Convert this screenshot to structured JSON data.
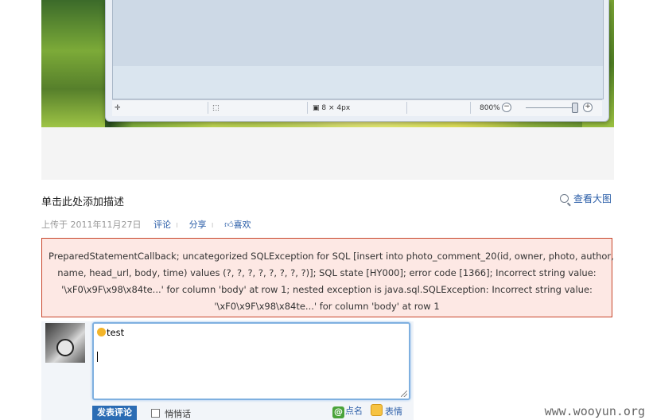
{
  "screenshot": {
    "statusbar": {
      "dimensions": "8 × 4px",
      "zoom_level": "800%",
      "zoom_out": "−",
      "zoom_in": "+"
    }
  },
  "photo": {
    "description": "单击此处添加描述",
    "view_large": "查看大图",
    "upload_meta": "上传于 2011年11月27日",
    "actions": {
      "comment": "评论",
      "share": "分享",
      "like": "喜欢"
    }
  },
  "error": {
    "lines": [
      "PreparedStatementCallback; uncategorized SQLException for SQL [insert into photo_comment_20(id, owner, photo, author,",
      "name, head_url, body, time) values (?, ?, ?, ?, ?, ?, ?, ?)]; SQL state [HY000]; error code [1366]; Incorrect string value:",
      "'\\xF0\\x9F\\x98\\x84te...' for column 'body' at row 1; nested exception is java.sql.SQLException: Incorrect string value:",
      "'\\xF0\\x9F\\x98\\x84te...' for column 'body' at row 1"
    ],
    "border_color": "#c8442a",
    "background_color": "#fde8e4"
  },
  "comment_form": {
    "text_value": "test",
    "submit_label": "发表评论",
    "whisper_label": "悄悄话",
    "whisper_checked": false,
    "mention_label": "点名",
    "mention_icon": "@",
    "emoji_label": "表情"
  },
  "watermark": "www.wooyun.org",
  "colors": {
    "link": "#2b5ea8",
    "accent_button": "#2b6cb4"
  }
}
